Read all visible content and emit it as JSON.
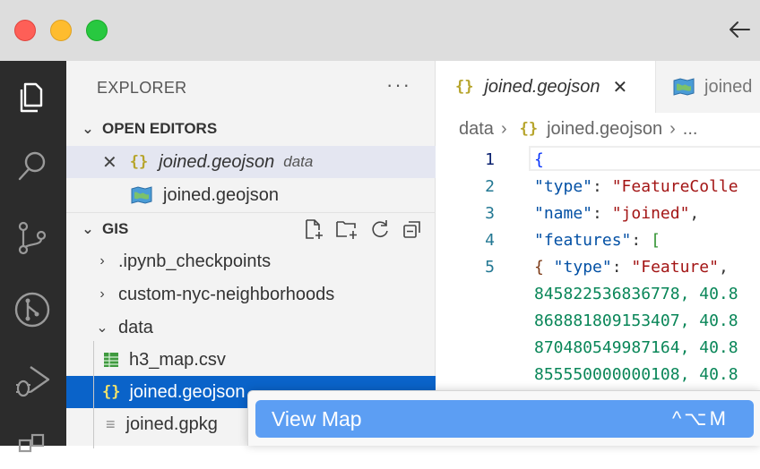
{
  "sidebar": {
    "title": "EXPLORER",
    "more": "···",
    "open_editors": {
      "label": "OPEN EDITORS",
      "items": [
        {
          "name": "joined.geojson",
          "description": "data",
          "icon": "json-braces-icon"
        },
        {
          "name": "joined.geojson",
          "icon": "map-icon"
        }
      ]
    },
    "workspace": {
      "label": "GIS",
      "folders": [
        ".ipynb_checkpoints",
        "custom-nyc-neighborhoods",
        "data"
      ],
      "files": [
        "h3_map.csv",
        "joined.geojson",
        "joined.gpkg"
      ]
    }
  },
  "editor": {
    "tabs": [
      {
        "label": "joined.geojson",
        "icon": "json-braces-icon",
        "active": true
      },
      {
        "label": "joined",
        "icon": "map-icon",
        "active": false
      }
    ],
    "breadcrumb": {
      "folder": "data",
      "file": "joined.geojson",
      "more": "..."
    },
    "lines": [
      {
        "num": "1",
        "brace": "{"
      },
      {
        "num": "2",
        "key": "\"type\"",
        "colon": ": ",
        "value": "\"FeatureColle"
      },
      {
        "num": "3",
        "key": "\"name\"",
        "colon": ": ",
        "value": "\"joined\"",
        "tail": ","
      },
      {
        "num": "4",
        "key": "\"features\"",
        "colon": ": ",
        "bracket": "["
      },
      {
        "num": "5",
        "brace": "{",
        "key": " \"type\"",
        "colon": ": ",
        "value": "\"Feature\"",
        "tail": ","
      },
      {
        "num": "",
        "number": "845822536836778",
        "tail": ", 40.8"
      },
      {
        "num": "",
        "number": "868881809153407",
        "tail": ", 40.8"
      },
      {
        "num": "",
        "number": "870480549987164",
        "tail": ", 40.8"
      },
      {
        "num": "",
        "number": "855550000000108",
        "tail": ", 40.8"
      }
    ]
  },
  "popup": {
    "label": "View Map",
    "shortcut": "^⌥M"
  },
  "colors": {
    "activity_bar": "#2c2c2c",
    "selection": "#0a63c9",
    "popup_highlight": "#5c9ef3"
  }
}
